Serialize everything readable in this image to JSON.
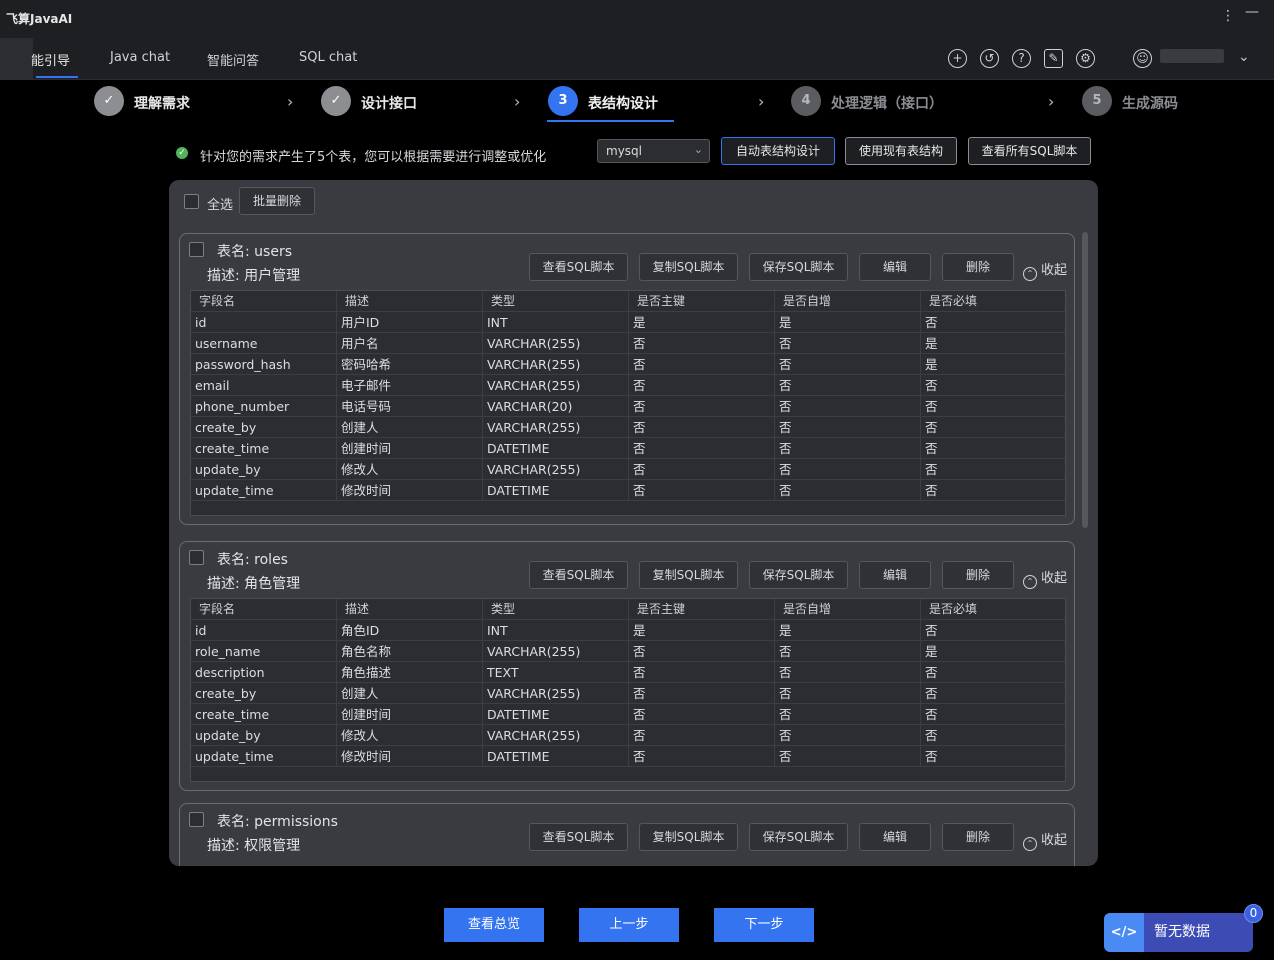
{
  "app": {
    "title": "飞算JavaAI"
  },
  "tabs": [
    {
      "label": "能引导",
      "active": true
    },
    {
      "label": "Java chat"
    },
    {
      "label": "智能问答"
    },
    {
      "label": "SQL chat"
    }
  ],
  "toolbar_icons": [
    "add-icon",
    "history-icon",
    "help-icon",
    "edit-icon",
    "settings-icon",
    "user-icon",
    "chevron-down-icon"
  ],
  "steps": [
    {
      "index": "✓",
      "label": "理解需求",
      "state": "done"
    },
    {
      "index": "✓",
      "label": "设计接口",
      "state": "done"
    },
    {
      "index": "3",
      "label": "表结构设计",
      "state": "active"
    },
    {
      "index": "4",
      "label": "处理逻辑（接口）",
      "state": "todo"
    },
    {
      "index": "5",
      "label": "生成源码",
      "state": "todo"
    }
  ],
  "info": {
    "message": "针对您的需求产生了5个表，您可以根据需要进行调整或优化",
    "db_type": "mysql",
    "auto_design": "自动表结构设计",
    "use_existing": "使用现有表结构",
    "view_all_sql": "查看所有SQL脚本"
  },
  "list": {
    "select_all": "全选",
    "batch_delete": "批量删除"
  },
  "card_actions": {
    "view_sql": "查看SQL脚本",
    "copy_sql": "复制SQL脚本",
    "save_sql": "保存SQL脚本",
    "edit": "编辑",
    "delete": "删除",
    "collapse": "收起"
  },
  "columns": [
    "字段名",
    "描述",
    "类型",
    "是否主键",
    "是否自增",
    "是否必填"
  ],
  "tables": [
    {
      "name": "表名: users",
      "desc": "描述: 用户管理",
      "rows": [
        [
          "id",
          "用户ID",
          "INT",
          "是",
          "是",
          "否"
        ],
        [
          "username",
          "用户名",
          "VARCHAR(255)",
          "否",
          "否",
          "是"
        ],
        [
          "password_hash",
          "密码哈希",
          "VARCHAR(255)",
          "否",
          "否",
          "是"
        ],
        [
          "email",
          "电子邮件",
          "VARCHAR(255)",
          "否",
          "否",
          "否"
        ],
        [
          "phone_number",
          "电话号码",
          "VARCHAR(20)",
          "否",
          "否",
          "否"
        ],
        [
          "create_by",
          "创建人",
          "VARCHAR(255)",
          "否",
          "否",
          "否"
        ],
        [
          "create_time",
          "创建时间",
          "DATETIME",
          "否",
          "否",
          "否"
        ],
        [
          "update_by",
          "修改人",
          "VARCHAR(255)",
          "否",
          "否",
          "否"
        ],
        [
          "update_time",
          "修改时间",
          "DATETIME",
          "否",
          "否",
          "否"
        ]
      ]
    },
    {
      "name": "表名: roles",
      "desc": "描述: 角色管理",
      "rows": [
        [
          "id",
          "角色ID",
          "INT",
          "是",
          "是",
          "否"
        ],
        [
          "role_name",
          "角色名称",
          "VARCHAR(255)",
          "否",
          "否",
          "是"
        ],
        [
          "description",
          "角色描述",
          "TEXT",
          "否",
          "否",
          "否"
        ],
        [
          "create_by",
          "创建人",
          "VARCHAR(255)",
          "否",
          "否",
          "否"
        ],
        [
          "create_time",
          "创建时间",
          "DATETIME",
          "否",
          "否",
          "否"
        ],
        [
          "update_by",
          "修改人",
          "VARCHAR(255)",
          "否",
          "否",
          "否"
        ],
        [
          "update_time",
          "修改时间",
          "DATETIME",
          "否",
          "否",
          "否"
        ]
      ]
    },
    {
      "name": "表名: permissions",
      "desc": "描述: 权限管理",
      "rows": []
    }
  ],
  "footer": {
    "overview": "查看总览",
    "prev": "上一步",
    "next": "下一步"
  },
  "widget": {
    "icon": "</>",
    "text": "暂无数据",
    "badge": "0"
  },
  "colors": {
    "accent": "#3574f0",
    "success": "#4fb35a",
    "panel": "#393b40"
  }
}
